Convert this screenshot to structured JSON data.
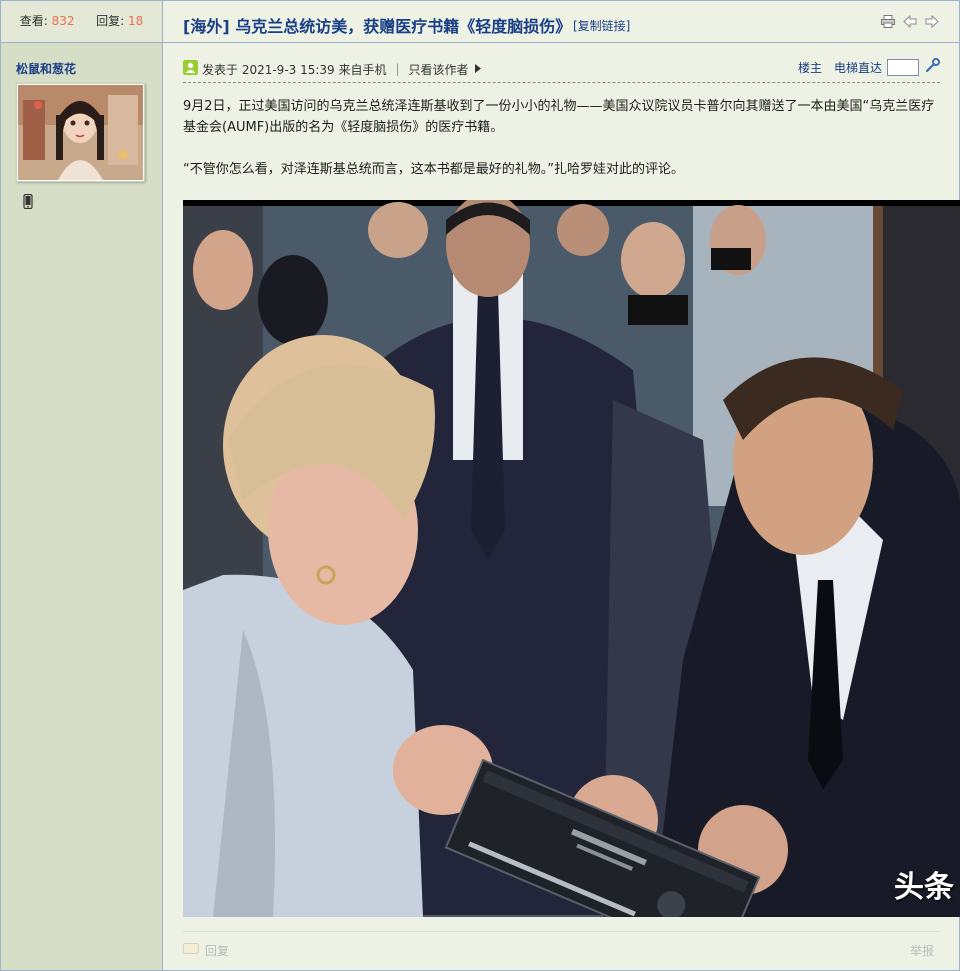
{
  "stats": {
    "views_label": "查看:",
    "views_count": "832",
    "replies_label": "回复:",
    "replies_count": "18"
  },
  "author": {
    "name": "松鼠和葱花"
  },
  "thread": {
    "title": "[海外] 乌克兰总统访美，获赠医疗书籍《轻度脑损伤》",
    "copy_link_label": "[复制链接]"
  },
  "post_meta": {
    "posted_text": "发表于 2021-9-3 15:39 来自手机",
    "only_author_label": "只看该作者",
    "floor_label": "楼主",
    "jump_label": "电梯直达"
  },
  "post": {
    "paragraph1": "9月2日，正过美国访问的乌克兰总统泽连斯基收到了一份小小的礼物——美国众议院议员卡普尔向其赠送了一本由美国“乌克兰医疗基金会(AUMF)出版的名为《轻度脑损伤》的医疗书籍。",
    "paragraph2": "“不管你怎么看，对泽连斯基总统而言，这本书都是最好的礼物。”扎哈罗娃对此的评论。",
    "image_watermark": "头条"
  },
  "footer": {
    "reply_label": "回复",
    "report_label": "举报"
  },
  "colors": {
    "link_blue": "#1b3f85",
    "count_orange": "#f26c4f",
    "sidebar_bg": "#d6dec7",
    "page_bg": "#eef2e4",
    "border": "#9fb1c9"
  },
  "icons": [
    "mobile-icon",
    "print-icon",
    "prev-arrow-icon",
    "next-arrow-icon",
    "online-user-icon",
    "triangle-right-icon",
    "wrench-icon",
    "reply-icon"
  ]
}
